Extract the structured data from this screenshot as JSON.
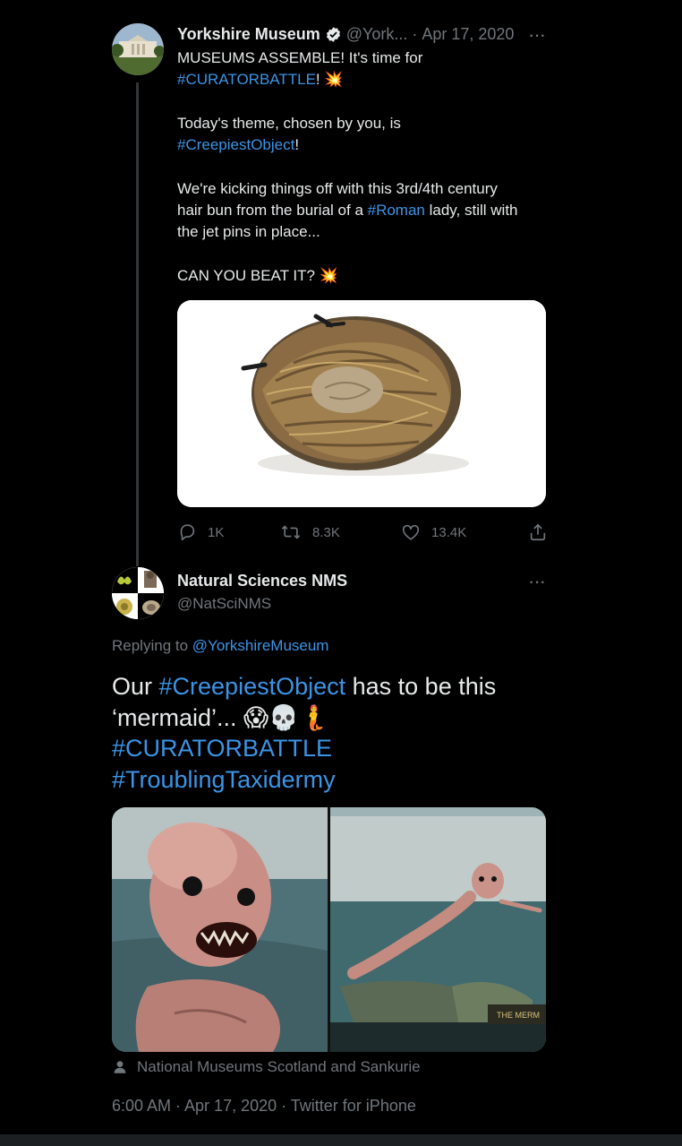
{
  "tweet1": {
    "author_name": "Yorkshire Museum",
    "handle": "@York...",
    "separator": "·",
    "date": "Apr 17, 2020",
    "more_label": "···",
    "text": {
      "l1": "MUSEUMS ASSEMBLE! It's time for",
      "l2_tag": "#CURATORBATTLE",
      "l2_rest": "! 💥",
      "l3": "Today's theme, chosen by you, is",
      "l4_tag": "#CreepiestObject",
      "l4_rest": "!",
      "l5": "We're kicking things off with this 3rd/4th century",
      "l6_pre": "hair bun from the burial of a ",
      "l6_tag": "#Roman",
      "l6_post": " lady, still with",
      "l7": "the jet pins in place...",
      "l8": "CAN YOU BEAT IT? 💥"
    },
    "actions": {
      "replies": "1K",
      "retweets": "8.3K",
      "likes": "13.4K"
    }
  },
  "tweet2": {
    "author_name": "Natural Sciences NMS",
    "handle": "@NatSciNMS",
    "more_label": "···",
    "replying_prefix": "Replying to ",
    "replying_to": "@YorkshireMuseum",
    "text": {
      "l1_pre": "Our ",
      "l1_tag": "#CreepiestObject",
      "l1_post": " has to be this",
      "l2": "‘mermaid’... 😱💀🧜",
      "l3_tag": "#CURATORBATTLE",
      "l4_tag": "#TroublingTaxidermy"
    },
    "image_caption": "THE MERM",
    "tagged_people": "National Museums Scotland and Sankurie",
    "meta": "6:00 AM · Apr 17, 2020 · Twitter for iPhone"
  },
  "colors": {
    "background": "#000000",
    "text": "#e7e9ea",
    "muted": "#71767b",
    "link": "#3b94e6"
  }
}
